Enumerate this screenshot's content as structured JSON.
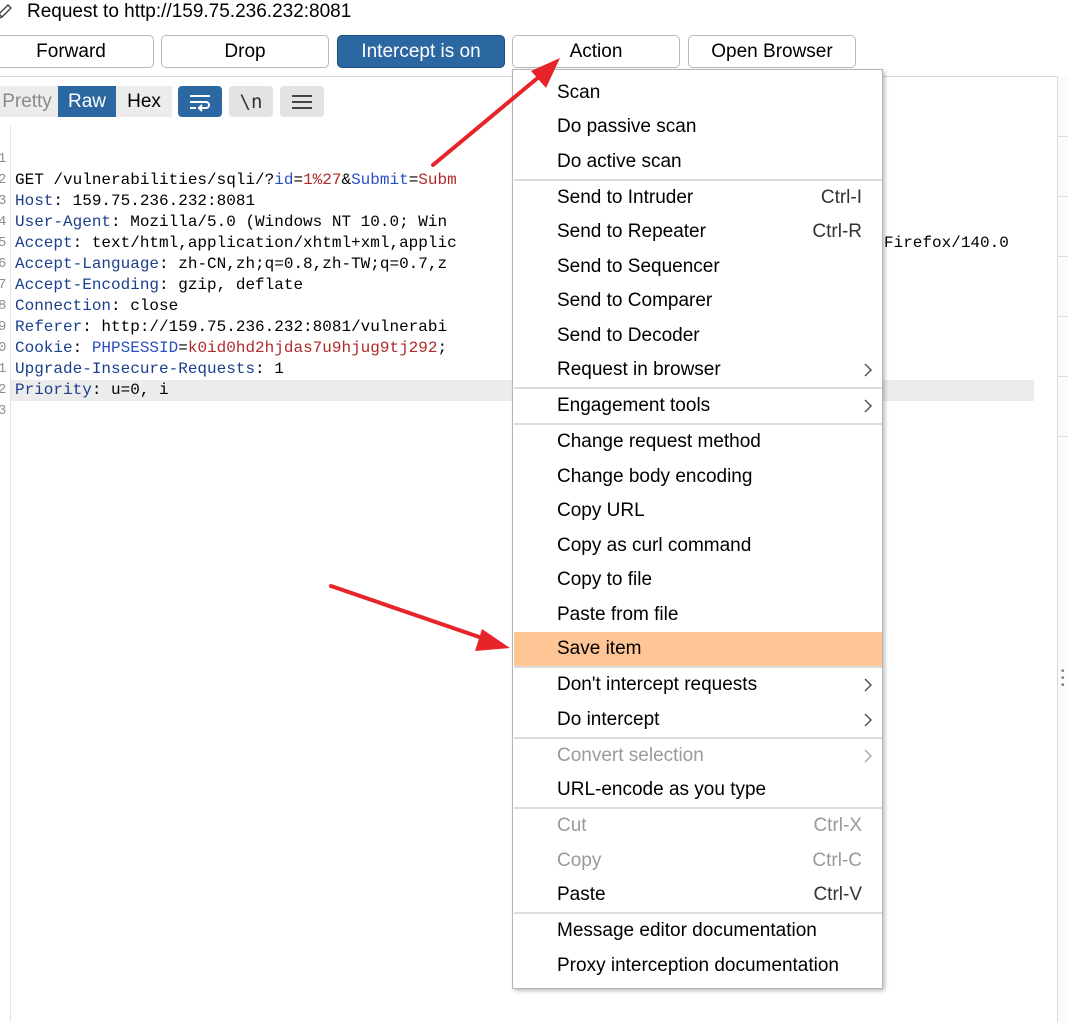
{
  "window": {
    "title": "Request to http://159.75.236.232:8081"
  },
  "toolbar": {
    "forward": "Forward",
    "drop": "Drop",
    "intercept": "Intercept is on",
    "action": "Action",
    "open_browser": "Open Browser"
  },
  "view_tabs": {
    "pretty": "Pretty",
    "raw": "Raw",
    "hex": "Hex",
    "newline_toggle": "\\n",
    "active": "Raw"
  },
  "icons": {
    "pencil": "pencil-icon",
    "wrap": "wrap-lines-icon",
    "menu": "hamburger-menu-icon",
    "submenu": "chevron-right-icon",
    "annotation": "red-arrow"
  },
  "colors": {
    "accent_blue": "#2b67a0",
    "menu_highlight": "#ffc594",
    "arrow_red": "#e8242b"
  },
  "editor": {
    "line_numbers": [
      "1",
      "2",
      "3",
      "4",
      "5",
      "6",
      "7",
      "8",
      "9",
      "0",
      "1",
      "2",
      "3"
    ],
    "lines": [
      {
        "plain": "GET /vulnerabilities/sqli/?",
        "key": "id",
        "eq": "=",
        "val": "1%27",
        "amp": "&",
        "key2": "Submit",
        "eq2": "=",
        "val2": "Subm"
      },
      {
        "name": "Host",
        "value": ": 159.75.236.232:8081"
      },
      {
        "name": "User-Agent",
        "value": ": Mozilla/5.0 (Windows NT 10.0; Win",
        "tail": "Firefox/140.0"
      },
      {
        "name": "Accept",
        "value": ": text/html,application/xhtml+xml,applic"
      },
      {
        "name": "Accept-Language",
        "value": ": zh-CN,zh;q=0.8,zh-TW;q=0.7,z"
      },
      {
        "name": "Accept-Encoding",
        "value": ": gzip, deflate"
      },
      {
        "name": "Connection",
        "value": ": close"
      },
      {
        "name": "Referer",
        "value": ": http://159.75.236.232:8081/vulnerabi"
      },
      {
        "name": "Cookie",
        "value": ": ",
        "cookie_key": "PHPSESSID",
        "cookie_eq": "=",
        "cookie_val": "k0id0hd2hjdas7u9hjug9tj292",
        "cookie_end": ";"
      },
      {
        "name": "Upgrade-Insecure-Requests",
        "value": ": 1"
      },
      {
        "name": "Priority",
        "value": ": u=0, i"
      }
    ]
  },
  "context_menu": {
    "scan": "Scan",
    "passive_scan": "Do passive scan",
    "active_scan": "Do active scan",
    "intruder": "Send to Intruder",
    "intruder_sc": "Ctrl-I",
    "repeater": "Send to Repeater",
    "repeater_sc": "Ctrl-R",
    "sequencer": "Send to Sequencer",
    "comparer": "Send to Comparer",
    "decoder": "Send to Decoder",
    "request_in_browser": "Request in browser",
    "engagement_tools": "Engagement tools",
    "change_method": "Change request method",
    "change_encoding": "Change body encoding",
    "copy_url": "Copy URL",
    "copy_curl": "Copy as curl command",
    "copy_to_file": "Copy to file",
    "paste_from_file": "Paste from file",
    "save_item": "Save item",
    "dont_intercept": "Don't intercept requests",
    "do_intercept": "Do intercept",
    "convert_selection": "Convert selection",
    "url_encode": "URL-encode as you type",
    "cut": "Cut",
    "cut_sc": "Ctrl-X",
    "copy": "Copy",
    "copy_sc": "Ctrl-C",
    "paste": "Paste",
    "paste_sc": "Ctrl-V",
    "editor_docs": "Message editor documentation",
    "proxy_docs": "Proxy interception documentation",
    "highlighted_item": "Save item"
  }
}
